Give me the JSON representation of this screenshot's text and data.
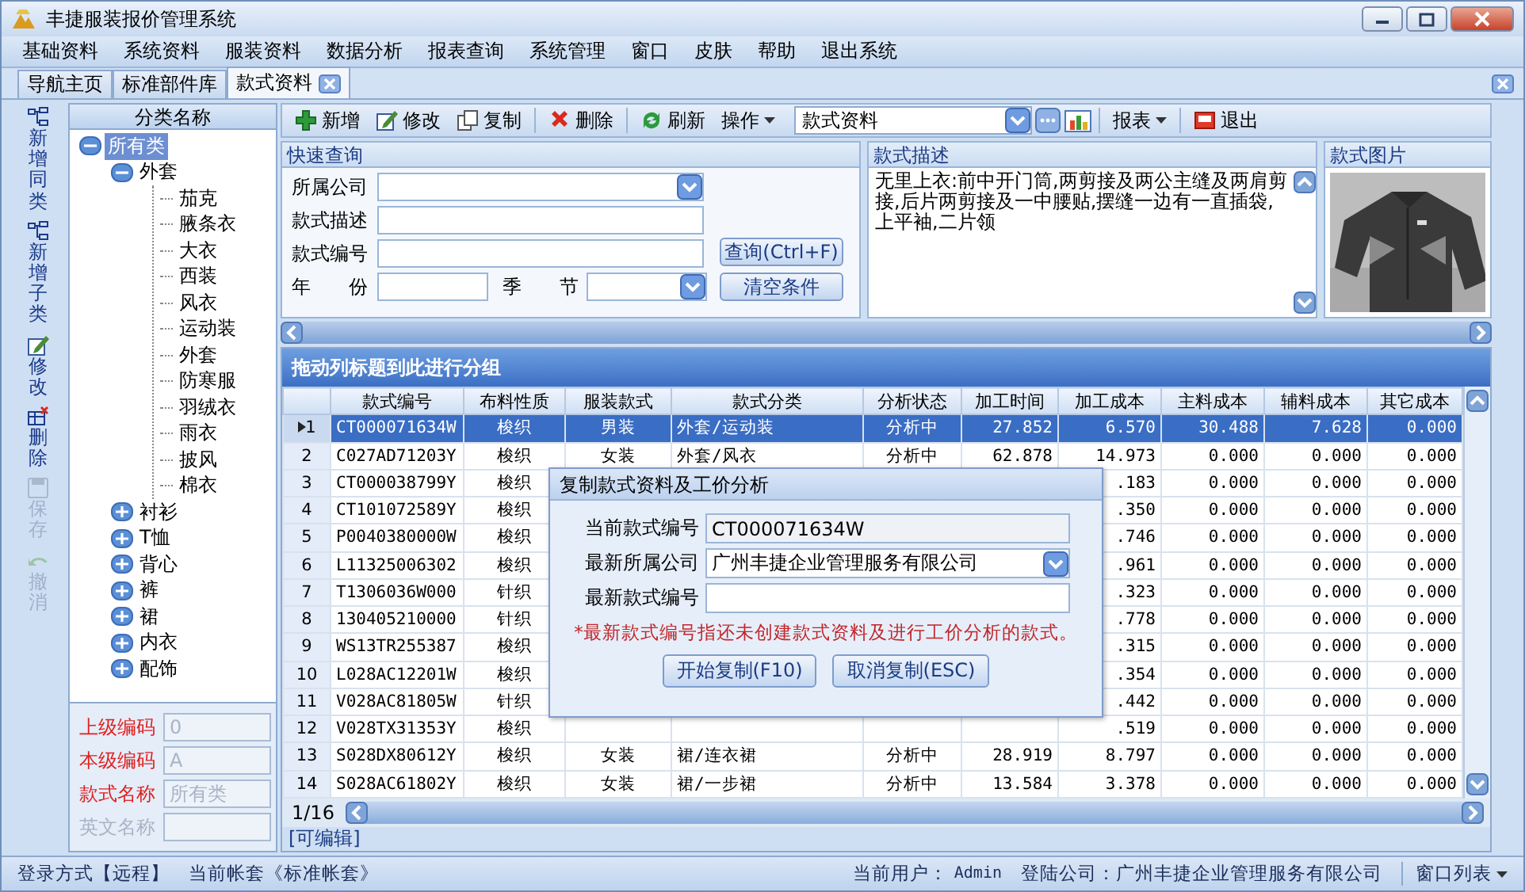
{
  "window": {
    "title": "丰捷服装报价管理系统"
  },
  "menu": [
    "基础资料",
    "系统资料",
    "服装资料",
    "数据分析",
    "报表查询",
    "系统管理",
    "窗口",
    "皮肤",
    "帮助",
    "退出系统"
  ],
  "tabs": [
    {
      "label": "导航主页",
      "selected": false,
      "closable": false
    },
    {
      "label": "标准部件库",
      "selected": false,
      "closable": false
    },
    {
      "label": "款式资料",
      "selected": true,
      "closable": true
    }
  ],
  "side_toolbar": [
    {
      "label": "新增同类",
      "kind": "tree",
      "disabled": false
    },
    {
      "label": "新增子类",
      "kind": "tree",
      "disabled": false
    },
    {
      "label": "修改",
      "kind": "edit",
      "disabled": false
    },
    {
      "label": "删除",
      "kind": "delete",
      "disabled": false
    },
    {
      "label": "保存",
      "kind": "save",
      "disabled": true
    },
    {
      "label": "撤消",
      "kind": "undo",
      "disabled": true
    }
  ],
  "tree": {
    "header": "分类名称",
    "items": [
      {
        "label": "所有类",
        "expanded": true,
        "selected": true,
        "children": [
          {
            "label": "外套",
            "expanded": true,
            "selected": false,
            "children": [
              {
                "label": "茄克",
                "selected": false
              },
              {
                "label": "腋条衣",
                "selected": false
              },
              {
                "label": "大衣",
                "selected": false
              },
              {
                "label": "西装",
                "selected": false
              },
              {
                "label": "风衣",
                "selected": false
              },
              {
                "label": "运动装",
                "selected": false
              },
              {
                "label": "外套",
                "selected": false
              },
              {
                "label": "防寒服",
                "selected": false
              },
              {
                "label": "羽绒衣",
                "selected": false
              },
              {
                "label": "雨衣",
                "selected": false
              },
              {
                "label": "披风",
                "selected": false
              },
              {
                "label": "棉衣",
                "selected": false
              }
            ]
          },
          {
            "label": "衬衫",
            "expanded": false,
            "selected": false
          },
          {
            "label": "T恤",
            "expanded": false,
            "selected": false
          },
          {
            "label": "背心",
            "expanded": false,
            "selected": false
          },
          {
            "label": "裤",
            "expanded": false,
            "selected": false
          },
          {
            "label": "裙",
            "expanded": false,
            "selected": false
          },
          {
            "label": "内衣",
            "expanded": false,
            "selected": false
          },
          {
            "label": "配饰",
            "expanded": false,
            "selected": false
          }
        ]
      }
    ]
  },
  "category_form": [
    {
      "label": "上级编码",
      "value": "0",
      "required": true
    },
    {
      "label": "本级编码",
      "value": "A",
      "required": true
    },
    {
      "label": "款式名称",
      "value": "所有类",
      "required": true
    },
    {
      "label": "英文名称",
      "required": false
    }
  ],
  "toolbar": [
    {
      "label": "新增",
      "kind": "add"
    },
    {
      "label": "修改",
      "kind": "edit"
    },
    {
      "label": "复制",
      "kind": "copy"
    },
    {
      "label": "删除",
      "kind": "delete"
    },
    {
      "label": "刷新",
      "kind": "refresh"
    },
    {
      "label": "操作",
      "kind": "menu"
    }
  ],
  "style_selector": {
    "value": "款式资料"
  },
  "report_button": "报表",
  "exit_button": "退出",
  "quick_query": {
    "title": "快速查询",
    "fields": [
      {
        "label": "所属公司",
        "kind": "select"
      },
      {
        "label": "款式描述",
        "kind": "text"
      },
      {
        "label": "款式编号",
        "kind": "text"
      }
    ],
    "year_label": "年　　份",
    "season_label": "季　　节",
    "buttons": [
      "查询(Ctrl+F)",
      "清空条件"
    ]
  },
  "description": {
    "title": "款式描述",
    "text": "无里上衣:前中开门筒,两剪接及两公主缝及两肩剪接,后片两剪接及一中腰贴,摆缝一边有一直插袋,上平袖,二片领"
  },
  "picture": {
    "title": "款式图片",
    "kind": "picture"
  },
  "grid": {
    "group_hint": "拖动列标题到此进行分组",
    "columns": [
      "款式编号",
      "布料性质",
      "服装款式",
      "款式分类",
      "分析状态",
      "加工时间",
      "加工成本",
      "主料成本",
      "辅料成本",
      "其它成本"
    ],
    "rows": [
      {
        "number": "1",
        "selected": true,
        "cells": [
          "CT000071634W",
          "梭织",
          "男装",
          "外套/运动装",
          "分析中",
          "27.852",
          "6.570",
          "30.488",
          "7.628",
          "0.000"
        ]
      },
      {
        "number": "2",
        "selected": false,
        "cells": [
          "C027AD71203Y",
          "梭织",
          "女装",
          "外套/风衣",
          "分析中",
          "62.878",
          "14.973",
          "0.000",
          "0.000",
          "0.000"
        ]
      },
      {
        "number": "3",
        "selected": false,
        "cells": [
          "CT000038799Y",
          "梭织",
          null,
          null,
          null,
          null,
          ".183",
          "0.000",
          "0.000",
          "0.000"
        ]
      },
      {
        "number": "4",
        "selected": false,
        "cells": [
          "CT101072589Y",
          "梭织",
          null,
          null,
          null,
          null,
          ".350",
          "0.000",
          "0.000",
          "0.000"
        ]
      },
      {
        "number": "5",
        "selected": false,
        "cells": [
          "P0040380000W",
          "梭织",
          null,
          null,
          null,
          null,
          ".746",
          "0.000",
          "0.000",
          "0.000"
        ]
      },
      {
        "number": "6",
        "selected": false,
        "cells": [
          "L11325006302",
          "梭织",
          null,
          null,
          null,
          null,
          ".961",
          "0.000",
          "0.000",
          "0.000"
        ]
      },
      {
        "number": "7",
        "selected": false,
        "cells": [
          "T1306036W000",
          "针织",
          null,
          null,
          null,
          null,
          ".323",
          "0.000",
          "0.000",
          "0.000"
        ]
      },
      {
        "number": "8",
        "selected": false,
        "cells": [
          "130405210000",
          "针织",
          null,
          null,
          null,
          null,
          ".778",
          "0.000",
          "0.000",
          "0.000"
        ]
      },
      {
        "number": "9",
        "selected": false,
        "cells": [
          "WS13TR255387",
          "梭织",
          null,
          null,
          null,
          null,
          ".315",
          "0.000",
          "0.000",
          "0.000"
        ]
      },
      {
        "number": "10",
        "selected": false,
        "cells": [
          "L028AC12201W",
          "梭织",
          null,
          null,
          null,
          null,
          ".354",
          "0.000",
          "0.000",
          "0.000"
        ]
      },
      {
        "number": "11",
        "selected": false,
        "cells": [
          "V028AC81805W",
          "针织",
          null,
          null,
          null,
          null,
          ".442",
          "0.000",
          "0.000",
          "0.000"
        ]
      },
      {
        "number": "12",
        "selected": false,
        "cells": [
          "V028TX31353Y",
          "梭织",
          null,
          null,
          null,
          null,
          ".519",
          "0.000",
          "0.000",
          "0.000"
        ]
      },
      {
        "number": "13",
        "selected": false,
        "cells": [
          "S028DX80612Y",
          "梭织",
          "女装",
          "裙/连衣裙",
          "分析中",
          "28.919",
          "8.797",
          "0.000",
          "0.000",
          "0.000"
        ]
      },
      {
        "number": "14",
        "selected": false,
        "cells": [
          "S028AC61802Y",
          "梭织",
          "女装",
          "裙/一步裙",
          "分析中",
          "13.584",
          "3.378",
          "0.000",
          "0.000",
          "0.000"
        ]
      }
    ],
    "pager": "1/16",
    "mode": "[可编辑]"
  },
  "dialog": {
    "title": "复制款式资料及工价分析",
    "fields": [
      {
        "label": "当前款式编号",
        "value": "CT000071634W",
        "kind": "readonly"
      },
      {
        "label": "最新所属公司",
        "value": "广州丰捷企业管理服务有限公司",
        "kind": "select"
      },
      {
        "label": "最新款式编号",
        "kind": "text"
      }
    ],
    "note": "*最新款式编号指还未创建款式资料及进行工价分析的款式。",
    "buttons": [
      "开始复制(F10)",
      "取消复制(ESC)"
    ]
  },
  "status_bar": {
    "login_mode": "登录方式【远程】",
    "account": "当前帐套《标准帐套》",
    "user_label": "当前用户：",
    "user": "Admin",
    "company_label": "登陆公司：",
    "company": "广州丰捷企业管理服务有限公司",
    "window_list": "窗口列表"
  }
}
